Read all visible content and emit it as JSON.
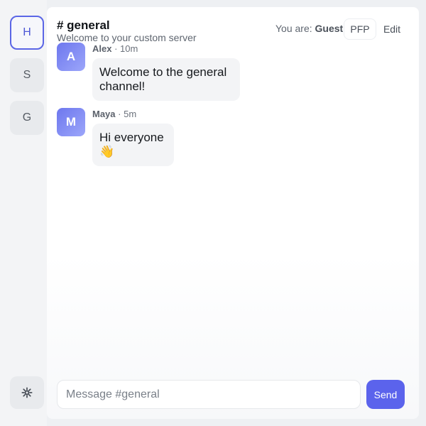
{
  "servers": [
    {
      "label": "H",
      "active": true
    },
    {
      "label": "S",
      "active": false
    },
    {
      "label": "G",
      "active": false
    }
  ],
  "settings_icon": "gear-icon",
  "channel": {
    "title": "# general",
    "subtitle": "Welcome to your custom server"
  },
  "header": {
    "you_are_label": "You are:",
    "user_name": "Guest",
    "pfp_label": "PFP",
    "edit_label": "Edit"
  },
  "messages": [
    {
      "initial": "A",
      "author": "Alex",
      "time": "10m",
      "text_line1": "Welcome to the general",
      "text_line2": "channel!"
    },
    {
      "initial": "M",
      "author": "Maya",
      "time": "5m",
      "text_line1": "Hi everyone",
      "text_line2": "👋"
    }
  ],
  "composer": {
    "placeholder": "Message #general",
    "send_label": "Send"
  },
  "colors": {
    "accent": "#5b63ec",
    "avatar_gradient_start": "#6d77ee",
    "avatar_gradient_end": "#9ca6fa"
  }
}
